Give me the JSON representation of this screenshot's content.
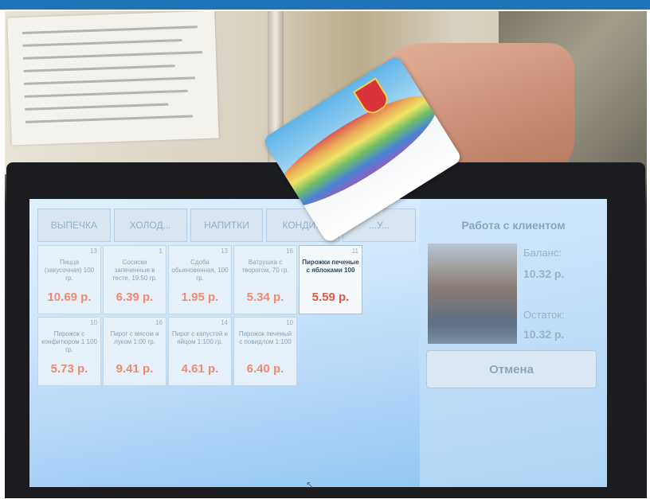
{
  "tabs": [
    {
      "label": "ВЫПЕЧКА"
    },
    {
      "label": "ХОЛОД..."
    },
    {
      "label": "НАПИТКИ"
    },
    {
      "label": "КОНДИ..."
    },
    {
      "label": "...У..."
    }
  ],
  "products": [
    {
      "num": "13",
      "name": "Пицца (закусочная) 100 гр.",
      "price": "10.69 р."
    },
    {
      "num": "1",
      "name": "Сосиски запеченные в тесте, 19.50 гр.",
      "price": "6.39 р."
    },
    {
      "num": "13",
      "name": "Сдоба обыкновенная, 100 гр.",
      "price": "1.95 р."
    },
    {
      "num": "16",
      "name": "Ватрушка с творогом, 70 гр.",
      "price": "5.34 р."
    },
    {
      "num": "11",
      "name": "Пирожки печеные с яблоками 100",
      "price": "5.59 р."
    },
    {
      "num": "10",
      "name": "Пирожок с конфитюром 1 100 гр.",
      "price": "5.73 р."
    },
    {
      "num": "16",
      "name": "Пирог с мясом и луком 1:00 гр.",
      "price": "9.41 р."
    },
    {
      "num": "14",
      "name": "Пирог с капустой и яйцом 1:100 гр.",
      "price": "4.61 р."
    },
    {
      "num": "10",
      "name": "Пирожок печеный с повидлом 1:100",
      "price": "6.40 р."
    }
  ],
  "client": {
    "title": "Работа с клиентом",
    "balance_label": "Баланс:",
    "balance_value": "10.32 р.",
    "remainder_label": "Остаток:",
    "remainder_value": "10.32 р.",
    "cancel_label": "Отмена"
  },
  "colors": {
    "banner": "#1f73b7",
    "price_text": "#f08a72",
    "active_price_text": "#e2563f"
  }
}
